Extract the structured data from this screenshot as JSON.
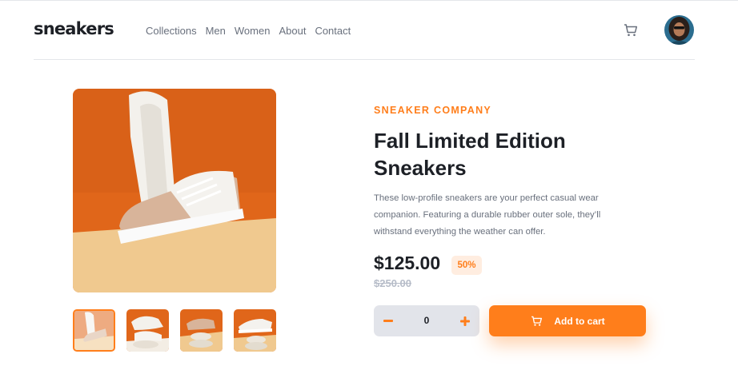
{
  "header": {
    "logo": "sneakers",
    "nav": [
      "Collections",
      "Men",
      "Women",
      "About",
      "Contact"
    ],
    "cart_icon": "cart-icon",
    "avatar": "user-avatar"
  },
  "product": {
    "company": "SNEAKER COMPANY",
    "title": "Fall Limited Edition Sneakers",
    "description": "These low-profile sneakers are your perfect casual wear companion. Featuring a durable rubber outer sole, they’ll withstand everything the weather can offer.",
    "price": "$125.00",
    "discount": "50%",
    "original_price": "$250.00",
    "quantity": "0",
    "add_to_cart": "Add to cart",
    "selected_thumbnail": 1
  },
  "colors": {
    "accent": "#ff7e1b",
    "accent_pale": "#ffede0",
    "text_dark": "#1d2026",
    "text_grey": "#69707d",
    "qty_bg": "#e2e4ea"
  }
}
